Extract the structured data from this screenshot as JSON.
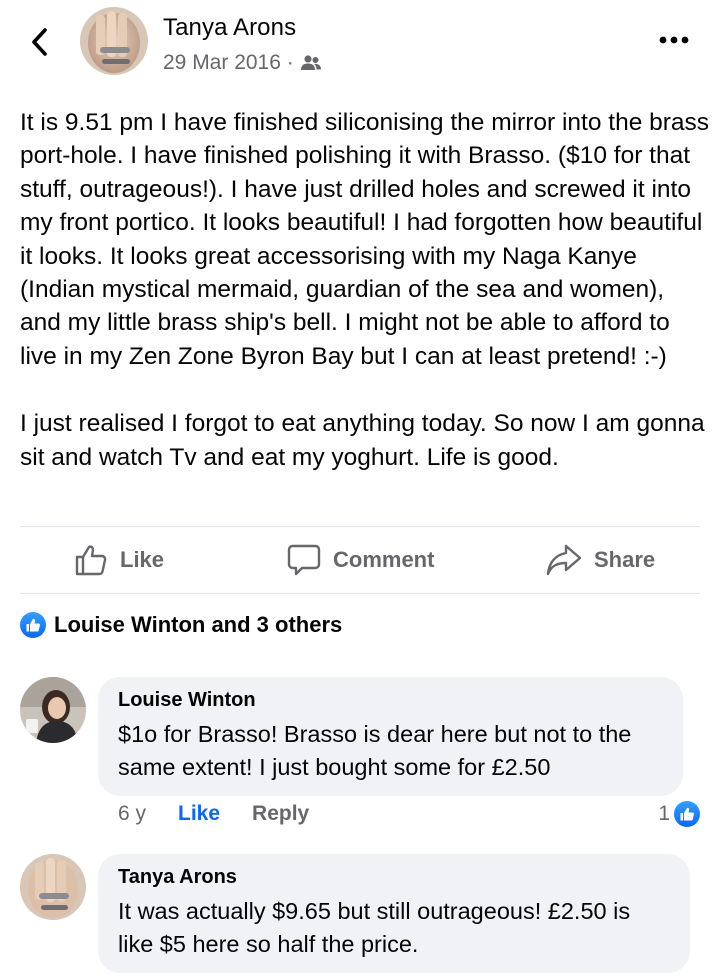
{
  "post": {
    "author": "Tanya Arons",
    "date": "29 Mar 2016 ·",
    "paragraphs": [
      "It is 9.51 pm I have finished siliconising the mirror into the brass port-hole.  I have finished polishing it with Brasso. ($10 for that stuff, outrageous!). I have just drilled holes and screwed it into my front portico. It looks beautiful!  I had forgotten how beautiful it looks.  It looks great accessorising with my Naga Kanye (Indian mystical mermaid, guardian of the sea and women), and my little brass ship's bell.  I might not be able to afford to live in my Zen Zone Byron Bay but I can at least pretend! :-)",
      "I just realised I forgot to eat anything today.  So now I am gonna sit and watch Tv and eat my yoghurt.  Life is good."
    ]
  },
  "actions": {
    "like": "Like",
    "comment": "Comment",
    "share": "Share"
  },
  "reactions": {
    "summary": "Louise Winton and 3 others"
  },
  "comments": [
    {
      "name": "Louise Winton",
      "text": "$1o for Brasso!   Brasso is dear here but not to the same extent!    I just bought some for £2.50",
      "age": "6 y",
      "like": "Like",
      "reply": "Reply",
      "reaction_count": "1"
    },
    {
      "name": "Tanya Arons",
      "text": "It was actually $9.65 but still outrageous!  £2.50 is like $5 here so half the price."
    }
  ],
  "icons": {
    "back": "chevron-left-icon",
    "more": "more-horizontal-icon",
    "audience": "friends-icon",
    "like": "thumbs-up-icon",
    "comment": "speech-bubble-icon",
    "share": "share-arrow-icon"
  },
  "colors": {
    "accent": "#0866ff",
    "secondary_text": "#65676b",
    "bubble": "#f0f2f5"
  }
}
